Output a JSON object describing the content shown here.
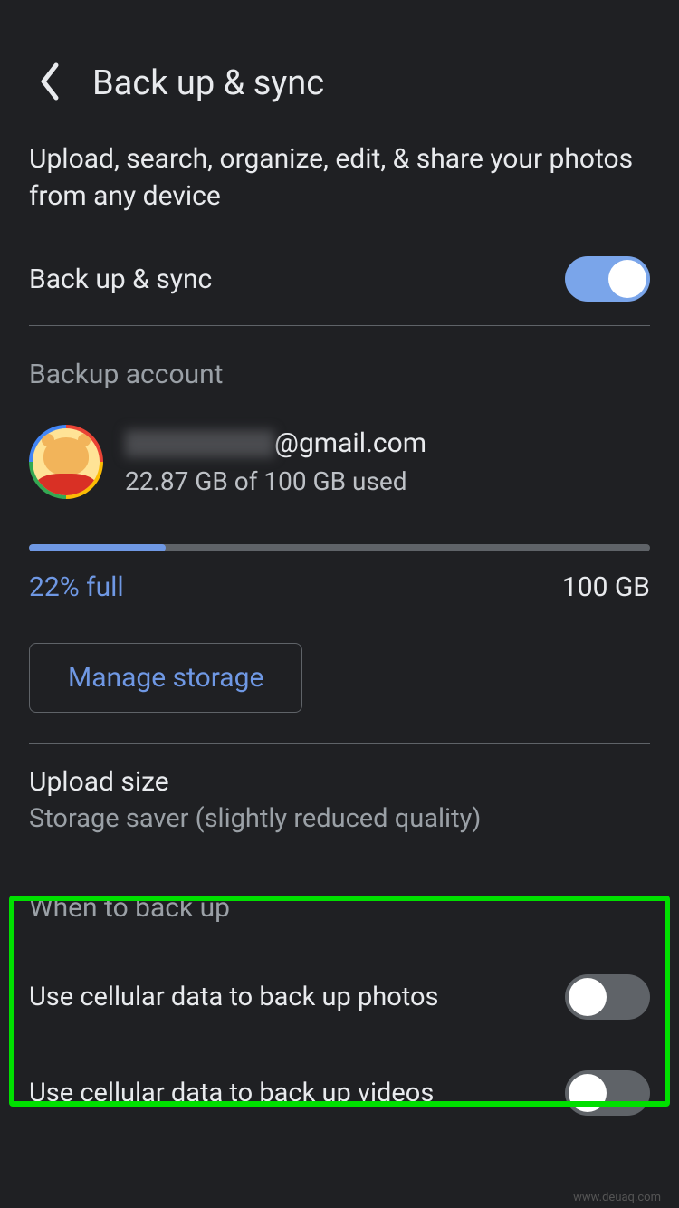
{
  "header": {
    "title": "Back up & sync"
  },
  "subtitle": "Upload, search, organize, edit, & share your photos from any device",
  "main_toggle": {
    "label": "Back up & sync",
    "on": true
  },
  "backup_account": {
    "section": "Backup account",
    "email_domain": "@gmail.com",
    "storage_used": "22.87 GB of 100 GB used",
    "percent_full": "22% full",
    "percent_value": 22,
    "total": "100 GB",
    "manage_button": "Manage storage"
  },
  "upload_size": {
    "title": "Upload size",
    "subtitle": "Storage saver (slightly reduced quality)"
  },
  "when_section": "When to back up",
  "cellular": {
    "photos": {
      "label": "Use cellular data to back up photos",
      "on": false
    },
    "videos": {
      "label": "Use cellular data to back up videos",
      "on": false
    }
  },
  "watermark": "www.deuaq.com"
}
